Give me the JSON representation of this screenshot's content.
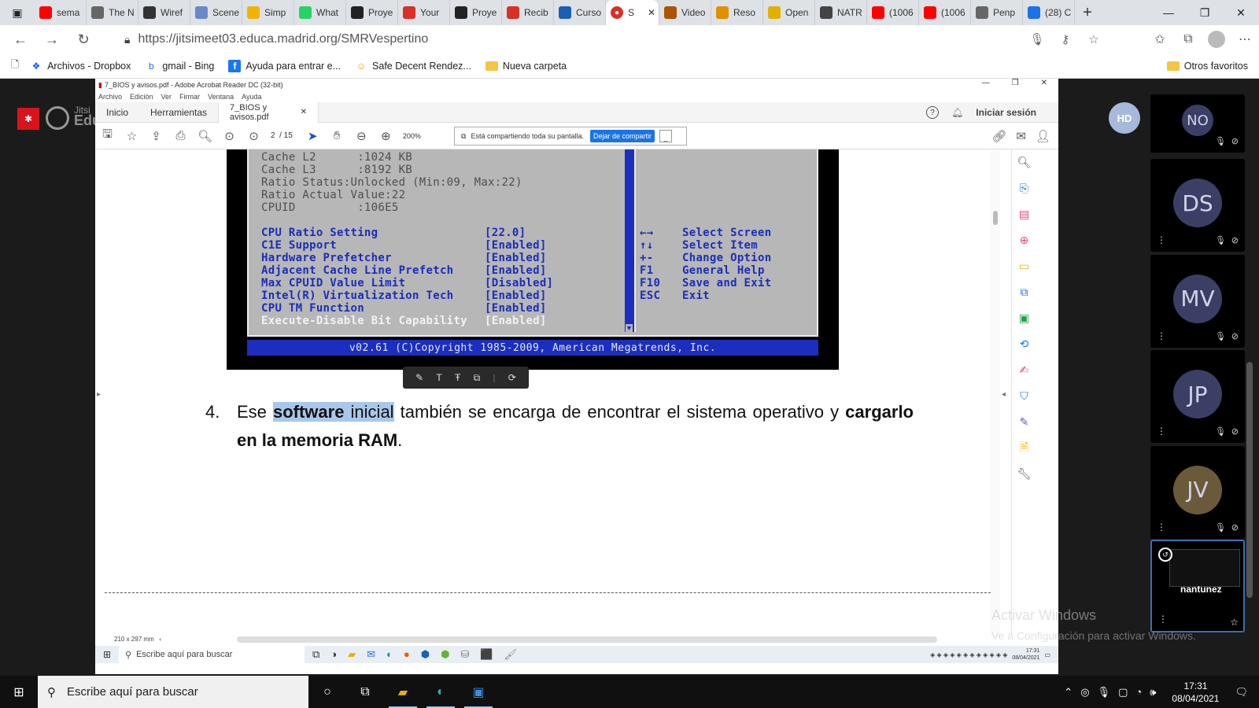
{
  "browser": {
    "tabs": [
      {
        "label": "sema",
        "icon": "youtube-icon",
        "color": "#ff0000"
      },
      {
        "label": "The N",
        "icon": "medium-icon",
        "color": "#666666"
      },
      {
        "label": "Wiref",
        "icon": "github-icon",
        "color": "#333333"
      },
      {
        "label": "Scene",
        "icon": "globe-icon",
        "color": "#6a88c8"
      },
      {
        "label": "Simp",
        "icon": "emoji-icon",
        "color": "#f0b400"
      },
      {
        "label": "What",
        "icon": "whatsapp-icon",
        "color": "#25d366"
      },
      {
        "label": "Proye",
        "icon": "notion-icon",
        "color": "#222222"
      },
      {
        "label": "Your",
        "icon": "gmail-icon",
        "color": "#d93025"
      },
      {
        "label": "Proye",
        "icon": "notion-icon",
        "color": "#222222"
      },
      {
        "label": "Recib",
        "icon": "gmail-icon",
        "color": "#d93025"
      },
      {
        "label": "Curso",
        "icon": "edu-icon",
        "color": "#1a5fb4"
      }
    ],
    "active_tab": {
      "label": "S",
      "icon": "record-icon",
      "color": "#d93025"
    },
    "tabs_after": [
      {
        "label": "Video",
        "icon": "lion-icon",
        "color": "#aa5500"
      },
      {
        "label": "Reso",
        "icon": "emoji-icon",
        "color": "#e08f00"
      },
      {
        "label": "Open",
        "icon": "openai-icon",
        "color": "#e0b000"
      },
      {
        "label": "NATR",
        "icon": "circle-icon",
        "color": "#444444"
      },
      {
        "label": "(1006",
        "icon": "youtube-icon",
        "color": "#ff0000"
      },
      {
        "label": "(1006",
        "icon": "youtube-icon",
        "color": "#ff0000"
      },
      {
        "label": "Penp",
        "icon": "box-icon",
        "color": "#666666"
      },
      {
        "label": "(28) C",
        "icon": "mail-icon",
        "color": "#1a73e8"
      }
    ],
    "url": "https://jitsimeet03.educa.madrid.org/SMRVespertino",
    "bookmarks": [
      {
        "label": "Archivos - Dropbox",
        "icon": "dropbox-icon"
      },
      {
        "label": "gmail - Bing",
        "icon": "bing-icon"
      },
      {
        "label": "Ayuda para entrar e...",
        "icon": "facebook-icon"
      },
      {
        "label": "Safe Decent Rendez...",
        "icon": "emoji-icon"
      },
      {
        "label": "Nueva carpeta",
        "icon": "folder-icon"
      }
    ],
    "other_favorites": "Otros favoritos"
  },
  "jitsi": {
    "logo_text_top": "Jitsi",
    "logo_text_bottom": "Edu",
    "self_initials": "HD",
    "participants": [
      {
        "initials": "NO",
        "color": "#3b3f66"
      },
      {
        "initials": "DS",
        "color": "#3b3f66"
      },
      {
        "initials": "MV",
        "color": "#3b3f66"
      },
      {
        "initials": "JP",
        "color": "#3b3f66"
      },
      {
        "initials": "JV",
        "color": "#6b5a3a"
      }
    ],
    "self_name": "nantunez",
    "activate_title": "Activar Windows",
    "activate_sub": "Ve a Configuración para activar Windows."
  },
  "acrobat": {
    "window_title": "7_BIOS y avisos.pdf - Adobe Acrobat Reader DC (32-bit)",
    "menu": [
      "Archivo",
      "Edición",
      "Ver",
      "Firmar",
      "Ventana",
      "Ayuda"
    ],
    "tab_home": "Inicio",
    "tab_tools": "Herramientas",
    "tab_doc": "7_BIOS y avisos.pdf",
    "sign_in": "Iniciar sesión",
    "page_current": "2",
    "page_total": "/ 15",
    "zoom": "200%",
    "sharing_text": "Está compartiendo toda su pantalla.",
    "stop_sharing": "Dejar de compartir",
    "page_size": "210 x 297 mm",
    "bios": {
      "gray_lines": [
        "Cache L2      :1024 KB",
        "Cache L3      :8192 KB",
        "Ratio Status:Unlocked (Min:09, Max:22)",
        "Ratio Actual Value:22",
        "CPUID         :106E5"
      ],
      "settings": [
        {
          "name": "CPU Ratio Setting",
          "value": "[22.0]"
        },
        {
          "name": "C1E Support",
          "value": "[Enabled]"
        },
        {
          "name": "Hardware Prefetcher",
          "value": "[Enabled]"
        },
        {
          "name": "Adjacent Cache Line Prefetch",
          "value": "[Enabled]"
        },
        {
          "name": "Max CPUID Value Limit",
          "value": "[Disabled]"
        },
        {
          "name": "Intel(R) Virtualization Tech",
          "value": "[Enabled]"
        },
        {
          "name": "CPU TM Function",
          "value": "[Enabled]"
        }
      ],
      "selected": {
        "name": "Execute-Disable Bit Capability",
        "value": "[Enabled]"
      },
      "help_keys": [
        {
          "key": "←→",
          "action": "Select Screen"
        },
        {
          "key": "↑↓",
          "action": "Select Item"
        },
        {
          "key": "+-",
          "action": "Change Option"
        },
        {
          "key": "F1",
          "action": "General Help"
        },
        {
          "key": "F10",
          "action": "Save and Exit"
        },
        {
          "key": "ESC",
          "action": "Exit"
        }
      ],
      "footer": "v02.61 (C)Copyright 1985-2009, American Megatrends, Inc."
    },
    "paragraph": {
      "number": "4.",
      "pre": "Ese ",
      "highlight_bold": "software",
      "highlight_plain": " inicial",
      "post": " también se encarga de encontrar el sistema operativo y ",
      "bold_end": "cargarlo en la memoria RAM",
      "end": "."
    }
  },
  "inner_taskbar": {
    "search": "Escribe aquí para buscar",
    "time": "17:31",
    "date": "08/04/2021"
  },
  "taskbar": {
    "search": "Escribe aquí para buscar",
    "time": "17:31",
    "date": "08/04/2021"
  }
}
